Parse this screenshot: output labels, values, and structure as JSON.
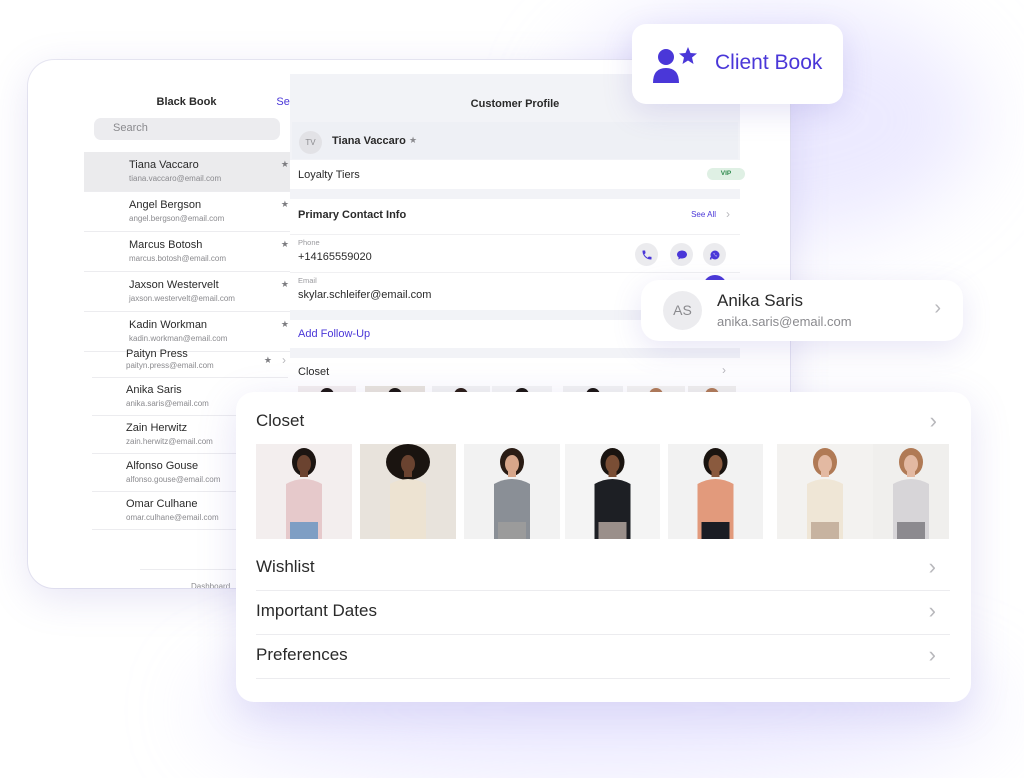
{
  "black_book": {
    "title": "Black Book",
    "select_label": "Select",
    "search_placeholder": "Search",
    "contacts": [
      {
        "name": "Tiana Vaccaro",
        "email": "tiana.vaccaro@email.com",
        "starred": true,
        "active": true
      },
      {
        "name": "Angel Bergson",
        "email": "angel.bergson@email.com",
        "starred": true
      },
      {
        "name": "Marcus Botosh",
        "email": "marcus.botosh@email.com",
        "starred": true
      },
      {
        "name": "Jaxson Westervelt",
        "email": "jaxson.westervelt@email.com",
        "starred": true
      },
      {
        "name": "Kadin Workman",
        "email": "kadin.workman@email.com",
        "starred": true
      }
    ],
    "lower_contacts": [
      {
        "name": "Paityn Press",
        "email": "paityn.press@email.com",
        "starred": true
      },
      {
        "name": "Anika Saris",
        "email": "anika.saris@email.com"
      },
      {
        "name": "Zain Herwitz",
        "email": "zain.herwitz@email.com"
      },
      {
        "name": "Alfonso Gouse",
        "email": "alfonso.gouse@email.com"
      },
      {
        "name": "Omar Culhane",
        "email": "omar.culhane@email.com"
      }
    ],
    "tabs": {
      "dashboard": "Dashboard",
      "client_book_icon": "client-book-icon"
    },
    "star_glyph": "★",
    "chevron_glyph": "›"
  },
  "profile": {
    "title": "Customer Profile",
    "initials": "TV",
    "name": "Tiana Vaccaro",
    "star_glyph": "★",
    "loyalty_label": "Loyalty Tiers",
    "loyalty_badge": "VIP",
    "primary_contact_label": "Primary Contact Info",
    "see_all": "See All",
    "phone_label": "Phone",
    "phone_value": "+14165559020",
    "email_label": "Email",
    "email_value": "skylar.schleifer@email.com",
    "actions": [
      "phone-icon",
      "message-icon",
      "whatsapp-icon"
    ],
    "add_follow_up": "Add Follow-Up",
    "closet_label": "Closet"
  },
  "client_book_card": {
    "label": "Client Book",
    "icon": "client-book-icon"
  },
  "anika_card": {
    "initials": "AS",
    "name": "Anika Saris",
    "email": "anika.saris@email.com"
  },
  "closet_card": {
    "title": "Closet",
    "photos": [
      {
        "desc": "pink hoodie",
        "bg": "#f3eeee",
        "garment": "#e6c9cb",
        "skin": "#6b4330",
        "hair": "#1c1512",
        "pants": "#7e9ec4"
      },
      {
        "desc": "cream turtleneck",
        "bg": "#e8e3dc",
        "garment": "#ede3d2",
        "skin": "#6a4330",
        "hair": "#1a1410",
        "pants": "#ede3d2"
      },
      {
        "desc": "plaid shirt",
        "bg": "#f2f2f2",
        "garment": "#8a8f96",
        "skin": "#d7a68a",
        "hair": "#2a1c14",
        "pants": "#9b9b9b"
      },
      {
        "desc": "black crop top",
        "bg": "#f4f4f4",
        "garment": "#1d1f24",
        "skin": "#7a4e35",
        "hair": "#1a1410",
        "pants": "#9a8f8a"
      },
      {
        "desc": "orange tee seated",
        "bg": "#f2f2f2",
        "garment": "#e29a7c",
        "skin": "#8a5a3e",
        "hair": "#1a1410",
        "pants": "#1b1d24"
      },
      {
        "desc": "cream wrap",
        "bg": "#f3f2f0",
        "garment": "#efe6d6",
        "skin": "#e3b9a2",
        "hair": "#b07a55",
        "pants": "#c7b3a0"
      },
      {
        "desc": "grey sweater boots",
        "bg": "#f0efed",
        "garment": "#d7d5d8",
        "skin": "#e3b9a2",
        "hair": "#b07a55",
        "pants": "#8c8a8f"
      }
    ],
    "rows": [
      {
        "label": "Wishlist"
      },
      {
        "label": "Important Dates"
      },
      {
        "label": "Preferences"
      }
    ],
    "chevron_glyph": "›"
  },
  "colors": {
    "accent": "#4a37d8",
    "vip_bg": "#dff0e4",
    "vip_text": "#2e8a4d"
  }
}
